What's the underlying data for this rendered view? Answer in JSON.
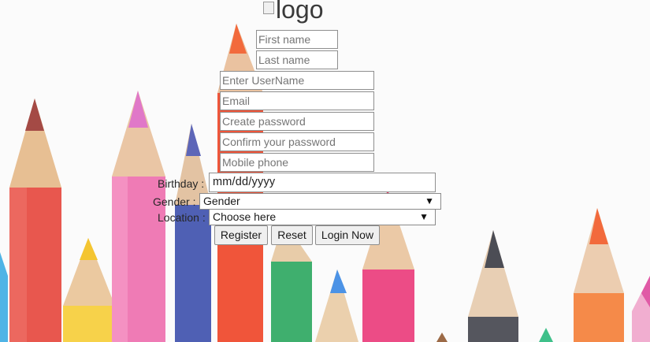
{
  "logo": {
    "alt_text": "logo"
  },
  "form": {
    "first_name_placeholder": "First name",
    "last_name_placeholder": "Last name",
    "username_placeholder": "Enter UserName",
    "email_placeholder": "Email",
    "password_placeholder": "Create password",
    "confirm_password_placeholder": "Confirm your password",
    "mobile_placeholder": "Mobile phone",
    "birthday_label": "Birthday :",
    "birthday_value": "mm/dd/yyyy",
    "gender_label": "Gender :",
    "gender_selected": "Gender",
    "location_label": "Location :",
    "location_selected": "Choose here"
  },
  "buttons": {
    "register": "Register",
    "reset": "Reset",
    "login": "Login Now"
  },
  "icons": {
    "select_arrow": "▼"
  },
  "colors": {
    "background": "#fbfbfb",
    "pencil_red": "#e8574e",
    "pencil_pink": "#ef7bb5",
    "pencil_blue": "#4f60b4",
    "pencil_orange": "#f26a3c",
    "pencil_green": "#3faf6e",
    "pencil_yellow": "#f4c531",
    "pencil_grey": "#4c4d55"
  }
}
